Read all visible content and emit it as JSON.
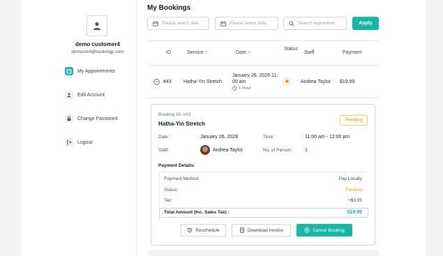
{
  "sidebar": {
    "username": "demo customer4",
    "email": "democst4@bookingp.com",
    "items": [
      {
        "label": "My Appointments",
        "icon": "calendar-icon",
        "active": true
      },
      {
        "label": "Edit Account",
        "icon": "user-icon",
        "active": false
      },
      {
        "label": "Change Password",
        "icon": "lock-icon",
        "active": false
      },
      {
        "label": "Logout",
        "icon": "logout-icon",
        "active": false
      }
    ]
  },
  "main": {
    "title": "My Bookings",
    "filters": {
      "start_date_placeholder": "Please select date",
      "end_date_placeholder": "Please select date",
      "search_placeholder": "Search appointme",
      "apply_label": "Apply"
    },
    "table": {
      "headers": [
        "ID",
        "Service",
        "Date",
        "Status",
        "Staff",
        "Payment"
      ],
      "row": {
        "id": "#43",
        "service": "Hatha-Yin Stretch",
        "date_line1": "January 26, 2026 11:",
        "date_line2": "00 am",
        "duration": "1 Hour",
        "staff": "Andrea Taylor",
        "payment": "$19.99",
        "status_color": "#f59e0b"
      }
    },
    "details": {
      "booking_id": "Booking ID: #43",
      "service": "Hatha-Yin Stretch",
      "status": "Pending",
      "date_label": "Date:",
      "date_value": "January 26, 2026",
      "time_label": "Time:",
      "time_value": "11:00 am - 12:00 pm",
      "staff_label": "Staff:",
      "staff_value": "Andrea Taylor",
      "persons_label": "No. of Person:",
      "persons_value": "1",
      "payment_details_label": "Payment Details:",
      "payment_method_label": "Payment Method:",
      "payment_method_value": "Pay Locally",
      "status_label": "Status:",
      "status_value": "Pending",
      "tax_label": "Tax:",
      "tax_value": "+$3.05",
      "total_label": "Total Amount (Inc. Sales Tax) :",
      "total_value": "$19.99",
      "reschedule_label": "Reschedule",
      "download_label": "Download Invoice",
      "cancel_label": "Cancel Booking"
    }
  },
  "colors": {
    "accent": "#14b8a6",
    "pending": "#f59e0b"
  }
}
